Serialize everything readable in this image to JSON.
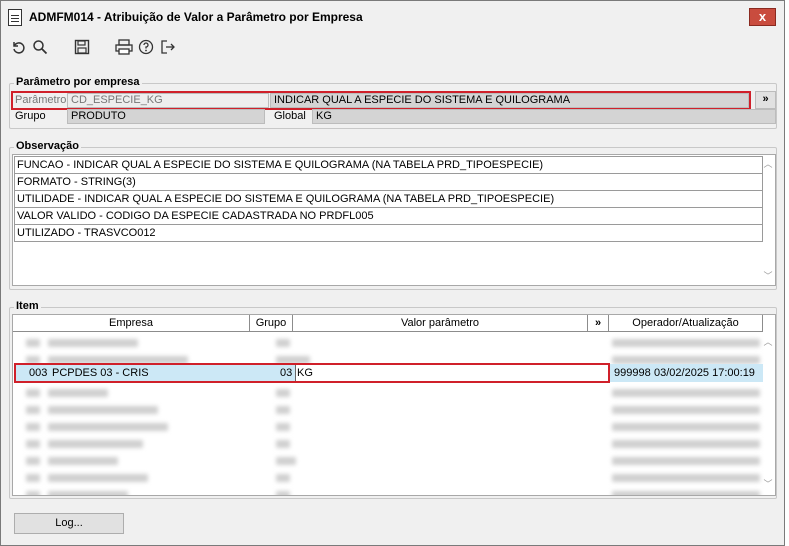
{
  "window": {
    "title": "ADMFM014 - Atribuição de Valor a Parâmetro por Empresa",
    "close_label": "x"
  },
  "toolbar": {
    "icons": [
      "undo-icon",
      "search-icon",
      "save-icon",
      "print-icon",
      "help-icon",
      "exit-icon"
    ]
  },
  "param_group": {
    "label": "Parâmetro por empresa",
    "parametro_label": "Parâmetro",
    "parametro_value": "CD_ESPECIE_KG",
    "parametro_desc": "INDICAR QUAL A ESPECIE DO SISTEMA E QUILOGRAMA",
    "expand_label": "»",
    "grupo_label": "Grupo",
    "grupo_value": "PRODUTO",
    "global_label": "Global",
    "global_value": "KG"
  },
  "obs_group": {
    "label": "Observação",
    "lines": [
      "FUNCAO -  INDICAR QUAL A ESPECIE DO SISTEMA E QUILOGRAMA (NA TABELA PRD_TIPOESPECIE)",
      "FORMATO - STRING(3)",
      "UTILIDADE -  INDICAR QUAL A ESPECIE DO SISTEMA E QUILOGRAMA (NA TABELA PRD_TIPOESPECIE)",
      "VALOR VALIDO - CODIGO DA ESPECIE CADASTRADA NO PRDFL005",
      "UTILIZADO - TRASVCO012"
    ]
  },
  "item_group": {
    "label": "Item",
    "headers": {
      "empresa": "Empresa",
      "grupo": "Grupo",
      "valor": "Valor parâmetro",
      "expand": "»",
      "operador": "Operador/Atualização"
    },
    "selected_row": {
      "code": "003",
      "name": "PCPDES 03 - CRIS",
      "grupo": "03",
      "valor": "KG",
      "operador": "999998",
      "data": "03/02/2025 17:00:19"
    }
  },
  "buttons": {
    "log": "Log..."
  },
  "colors": {
    "highlight": "#d0202a",
    "selected_row": "#cce8f6",
    "close_button": "#c94c3e"
  }
}
